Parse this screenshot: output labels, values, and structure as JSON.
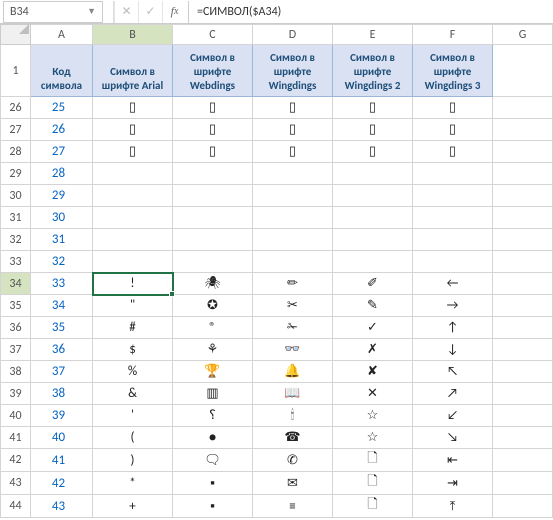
{
  "nameBox": {
    "value": "B34"
  },
  "formulaBar": {
    "value": "=СИМВОЛ($A34)"
  },
  "columns": [
    "A",
    "B",
    "C",
    "D",
    "E",
    "F",
    "G"
  ],
  "selectedCol": "B",
  "selectedRow": "34",
  "selectedCell": "B34",
  "headerRowNum": "1",
  "headers": {
    "A": "Код символа",
    "B": "Символ в шрифте Arial",
    "C": "Символ в шрифте Webdings",
    "D": "Символ в шрифте Wingdings",
    "E": "Символ в шрифте Wingdings 2",
    "F": "Символ в шрифте Wingdings 3"
  },
  "rows": [
    {
      "num": "26",
      "code": "25",
      "b": "▯",
      "c": "▯",
      "d": "▯",
      "e": "▯",
      "f": "▯"
    },
    {
      "num": "27",
      "code": "26",
      "b": "▯",
      "c": "▯",
      "d": "▯",
      "e": "▯",
      "f": "▯"
    },
    {
      "num": "28",
      "code": "27",
      "b": "▯",
      "c": "▯",
      "d": "▯",
      "e": "▯",
      "f": "▯"
    },
    {
      "num": "29",
      "code": "28",
      "b": "",
      "c": "",
      "d": "",
      "e": "",
      "f": ""
    },
    {
      "num": "30",
      "code": "29",
      "b": "",
      "c": "",
      "d": "",
      "e": "",
      "f": ""
    },
    {
      "num": "31",
      "code": "30",
      "b": "",
      "c": "",
      "d": "",
      "e": "",
      "f": ""
    },
    {
      "num": "32",
      "code": "31",
      "b": "",
      "c": "",
      "d": "",
      "e": "",
      "f": ""
    },
    {
      "num": "33",
      "code": "32",
      "b": "",
      "c": "",
      "d": "",
      "e": "",
      "f": ""
    },
    {
      "num": "34",
      "code": "33",
      "b": "!",
      "c": "🕷",
      "d": "✏",
      "e": "✐",
      "f": "←"
    },
    {
      "num": "35",
      "code": "34",
      "b": "\"",
      "c": "✪",
      "d": "✂",
      "e": "✎",
      "f": "→"
    },
    {
      "num": "36",
      "code": "35",
      "b": "#",
      "c": "®",
      "d": "✁",
      "e": "✓",
      "f": "↑"
    },
    {
      "num": "37",
      "code": "36",
      "b": "$",
      "c": "⚘",
      "d": "👓",
      "e": "✗",
      "f": "↓"
    },
    {
      "num": "38",
      "code": "37",
      "b": "%",
      "c": "🏆",
      "d": "🔔",
      "e": "✘",
      "f": "↖"
    },
    {
      "num": "39",
      "code": "38",
      "b": "&",
      "c": "▥",
      "d": "📖",
      "e": "✕",
      "f": "↗"
    },
    {
      "num": "40",
      "code": "39",
      "b": "'",
      "c": "⸮",
      "d": "🕯",
      "e": "☆",
      "f": "↙"
    },
    {
      "num": "41",
      "code": "40",
      "b": "(",
      "c": "●",
      "d": "☎",
      "e": "☆",
      "f": "↘"
    },
    {
      "num": "42",
      "code": "41",
      "b": ")",
      "c": "🗨",
      "d": "✆",
      "e": "🗋",
      "f": "⇤"
    },
    {
      "num": "43",
      "code": "42",
      "b": "*",
      "c": "▪",
      "d": "✉",
      "e": "🗋",
      "f": "⇥"
    },
    {
      "num": "44",
      "code": "43",
      "b": "+",
      "c": "▪",
      "d": "≡",
      "e": "🗋",
      "f": "⤒"
    }
  ]
}
